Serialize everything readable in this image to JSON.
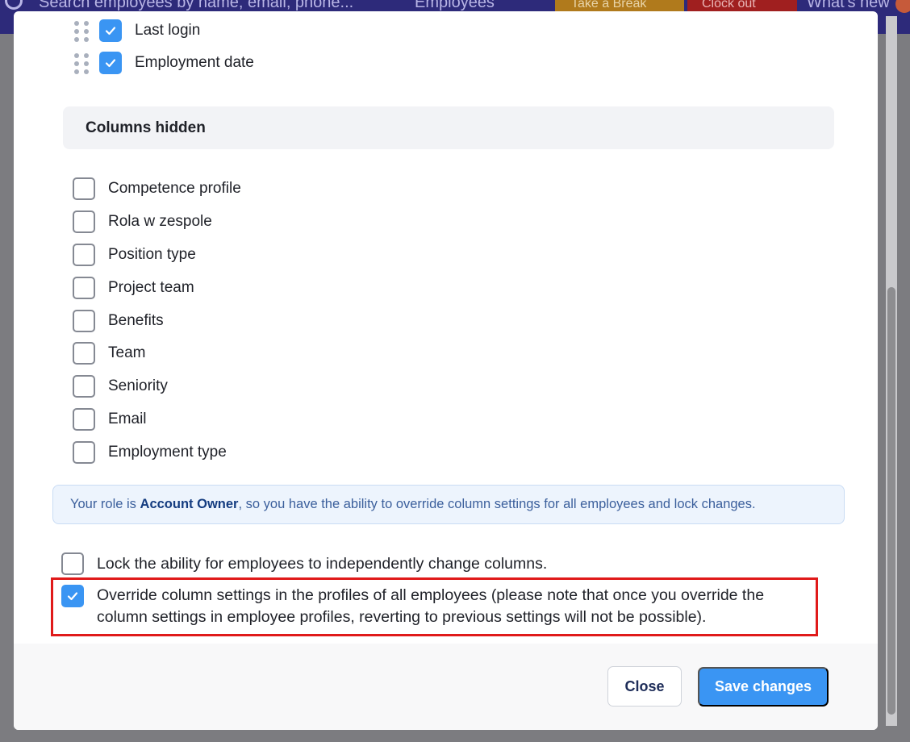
{
  "background": {
    "search_placeholder": "Search employees by name, email, phone...",
    "nav_label": "Employees",
    "take_break_label": "Take a Break",
    "clock_out_label": "Clock out",
    "whats_new_label": "What's new"
  },
  "modal": {
    "visible_columns": [
      {
        "label": "Last login",
        "checked": true
      },
      {
        "label": "Employment date",
        "checked": true
      }
    ],
    "hidden_section_title": "Columns hidden",
    "hidden_columns": [
      {
        "label": "Competence profile",
        "checked": false
      },
      {
        "label": "Rola w zespole",
        "checked": false
      },
      {
        "label": "Position type",
        "checked": false
      },
      {
        "label": "Project team",
        "checked": false
      },
      {
        "label": "Benefits",
        "checked": false
      },
      {
        "label": "Team",
        "checked": false
      },
      {
        "label": "Seniority",
        "checked": false
      },
      {
        "label": "Email",
        "checked": false
      },
      {
        "label": "Employment type",
        "checked": false
      }
    ],
    "info": {
      "prefix": "Your role is ",
      "role": "Account Owner",
      "suffix": ", so you have the ability to override column settings for all employees and lock changes."
    },
    "lock_option": {
      "label": "Lock the ability for employees to independently change columns.",
      "checked": false
    },
    "override_option": {
      "line1": "Override column settings in the profiles of all employees (please note that once you override the",
      "line2": "column settings in employee profiles, reverting to previous settings will not be possible).",
      "checked": true
    },
    "close_label": "Close",
    "save_label": "Save changes"
  },
  "colors": {
    "accent": "#3a95f3",
    "highlight": "#e01a1a",
    "info_bg": "#edf4fd"
  }
}
